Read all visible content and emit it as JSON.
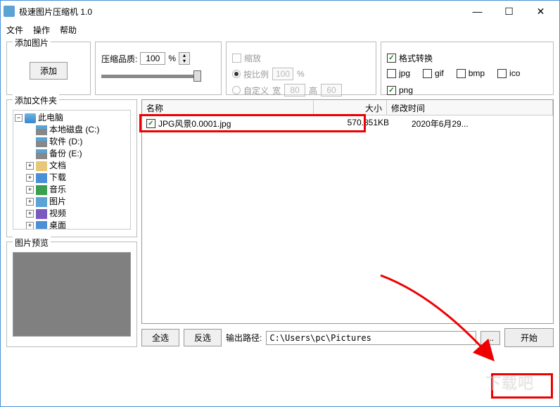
{
  "window": {
    "title": "极速图片压缩机 1.0"
  },
  "menu": {
    "file": "文件",
    "operate": "操作",
    "help": "帮助"
  },
  "groups": {
    "add_image": "添加图片",
    "add_folder": "添加文件夹",
    "preview": "图片预览"
  },
  "buttons": {
    "add": "添加",
    "select_all": "全选",
    "invert": "反选",
    "start": "开始"
  },
  "quality": {
    "label": "压缩品质:",
    "value": "100",
    "percent": "%"
  },
  "scale": {
    "enable": "缩放",
    "by_ratio": "按比例",
    "ratio_value": "100",
    "percent": "%",
    "custom": "自定义",
    "w_label": "宽",
    "w_value": "80",
    "h_label": "高",
    "h_value": "60"
  },
  "format": {
    "enable": "格式转换",
    "jpg": "jpg",
    "gif": "gif",
    "bmp": "bmp",
    "ico": "ico",
    "png": "png"
  },
  "tree": {
    "root": "此电脑",
    "drive_c": "本地磁盘 (C:)",
    "drive_d": "软件 (D:)",
    "drive_e": "备份 (E:)",
    "docs": "文档",
    "downloads": "下载",
    "music": "音乐",
    "pictures": "图片",
    "videos": "视频",
    "desktop": "桌面"
  },
  "columns": {
    "name": "名称",
    "size": "大小",
    "mtime": "修改时间"
  },
  "files": [
    {
      "name": "JPG风景0.0001.jpg",
      "size": "570.851KB",
      "mtime": "2020年6月29..."
    }
  ],
  "output": {
    "label": "输出路径:",
    "path": "C:\\Users\\pc\\Pictures",
    "browse": "..."
  },
  "watermark": "下载吧"
}
